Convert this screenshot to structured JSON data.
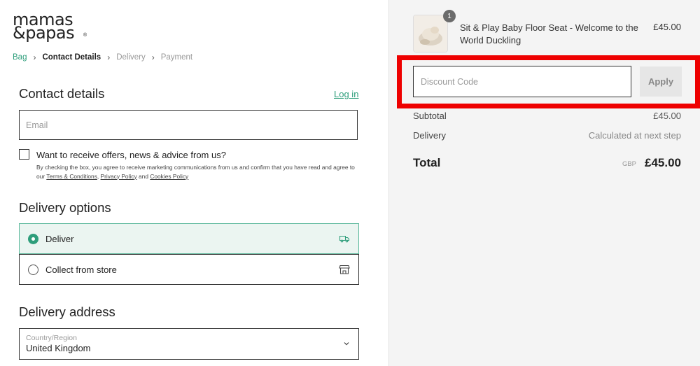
{
  "brand": {
    "logo_line1": "mamas",
    "logo_line2": "&papas",
    "logo_mark": "®"
  },
  "breadcrumb": [
    "Bag",
    "Contact Details",
    "Delivery",
    "Payment"
  ],
  "contact": {
    "title": "Contact details",
    "login_link": "Log in",
    "email_placeholder": "Email",
    "offers_label": "Want to receive offers, news & advice from us?",
    "fine_print_pre": "By checking the box, you agree to receive marketing communications from us and confirm that you have read and agree to our ",
    "terms_link": "Terms & Conditions",
    "comma": ", ",
    "privacy_link": "Privacy Policy",
    "and": " and ",
    "cookies_link": "Cookies Policy"
  },
  "delivery_options": {
    "title": "Delivery options",
    "deliver_label": "Deliver",
    "collect_label": "Collect from store"
  },
  "delivery_address": {
    "title": "Delivery address",
    "country_label": "Country/Region",
    "country_value": "United Kingdom"
  },
  "summary": {
    "item_quantity": "1",
    "item_name": "Sit & Play Baby Floor Seat - Welcome to the World Duckling",
    "item_price": "£45.00",
    "discount_placeholder": "Discount Code",
    "apply_label": "Apply",
    "subtotal_label": "Subtotal",
    "subtotal_value": "£45.00",
    "delivery_label": "Delivery",
    "delivery_value": "Calculated at next step",
    "total_label": "Total",
    "total_currency": "GBP",
    "total_value": "£45.00"
  },
  "colors": {
    "accent": "#2e9e7b",
    "highlight": "#ee0000",
    "sidebar_bg": "#f4f4f4"
  },
  "icons": [
    "truck-icon",
    "store-icon",
    "chevron-down-icon",
    "chevron-right-icon"
  ]
}
